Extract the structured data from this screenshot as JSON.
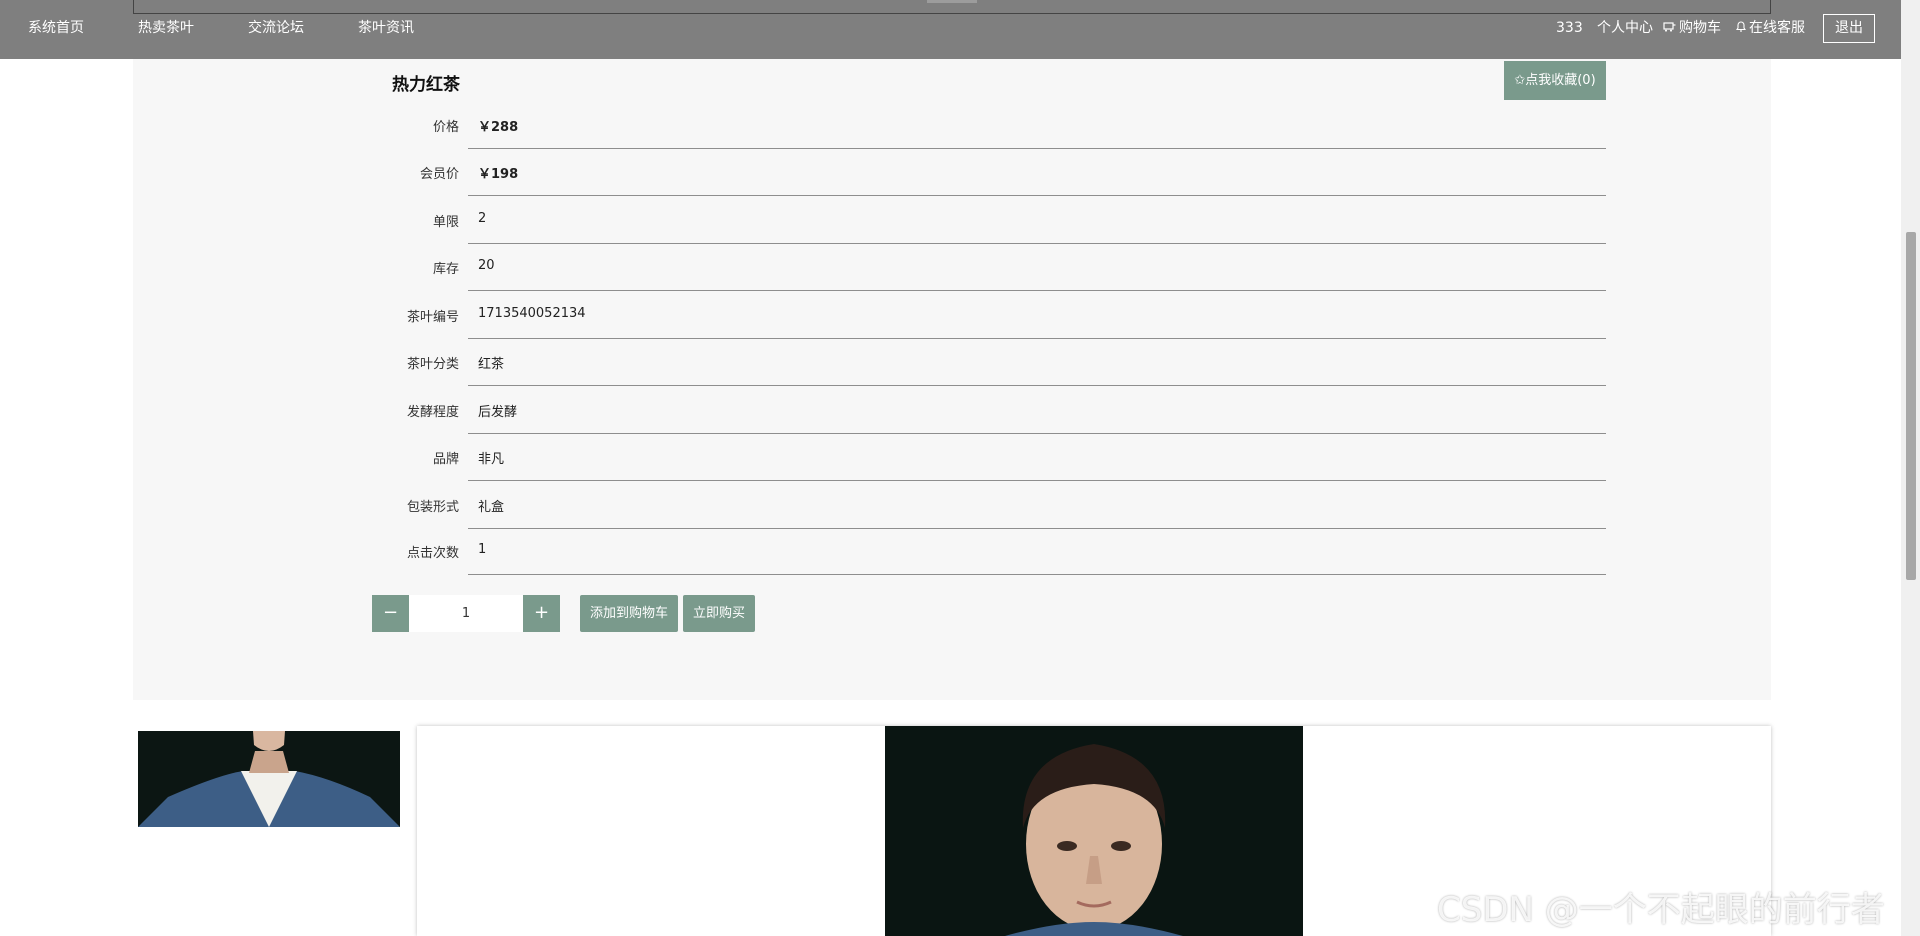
{
  "nav": {
    "items": [
      "系统首页",
      "热卖茶叶",
      "交流论坛",
      "茶叶资讯"
    ],
    "username": "333",
    "personal_center": "个人中心",
    "cart": "购物车",
    "service": "在线客服",
    "logout": "退出"
  },
  "product": {
    "title": "热力红茶",
    "favorite_label": "✩点我收藏(0)",
    "details": [
      {
        "label": "价格",
        "value": "￥288"
      },
      {
        "label": "会员价",
        "value": "￥198"
      },
      {
        "label": "单限",
        "value": "2"
      },
      {
        "label": "库存",
        "value": "20"
      },
      {
        "label": "茶叶编号",
        "value": "1713540052134"
      },
      {
        "label": "茶叶分类",
        "value": "红茶"
      },
      {
        "label": "发酵程度",
        "value": "后发酵"
      },
      {
        "label": "品牌",
        "value": "非凡"
      },
      {
        "label": "包装形式",
        "value": "礼盒"
      },
      {
        "label": "点击次数",
        "value": "1"
      }
    ],
    "quantity": "1",
    "minus": "−",
    "plus": "+",
    "add_to_cart": "添加到购物车",
    "buy_now": "立即购买"
  },
  "watermark": "CSDN @一个不起眼的前行者",
  "colors": {
    "topbar": "#7f7f7f",
    "accent": "#7a9a8c",
    "panel": "#f7f7f7"
  }
}
